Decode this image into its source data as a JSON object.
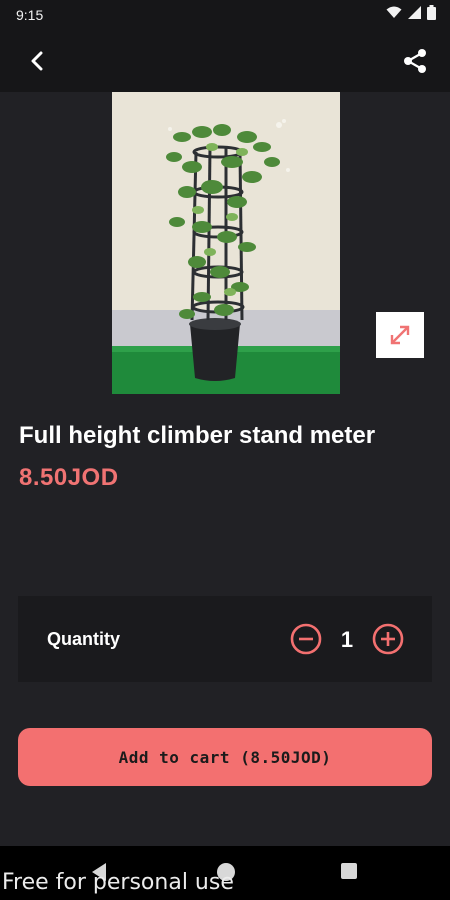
{
  "status_bar": {
    "time": "9:15",
    "icons": [
      "wifi-icon",
      "signal-icon",
      "battery-icon"
    ]
  },
  "app_bar": {
    "back_icon": "chevron-left-icon",
    "share_icon": "share-icon"
  },
  "product": {
    "image_description_icon": "plant-photo",
    "title": "Full height climber stand meter",
    "price": "8.50JOD",
    "expand_icon": "expand-icon"
  },
  "quantity": {
    "label": "Quantity",
    "value": "1",
    "minus_icon": "minus-circle-icon",
    "plus_icon": "plus-circle-icon"
  },
  "cart": {
    "button_label": "Add to cart (8.50JOD)"
  },
  "navigation": {
    "back_icon": "triangle-back-icon",
    "home_icon": "circle-home-icon",
    "recents_icon": "square-recents-icon"
  },
  "watermark": "Free for personal use",
  "colors": {
    "accent": "#f37070",
    "background": "#212125",
    "bar": "#161618"
  }
}
